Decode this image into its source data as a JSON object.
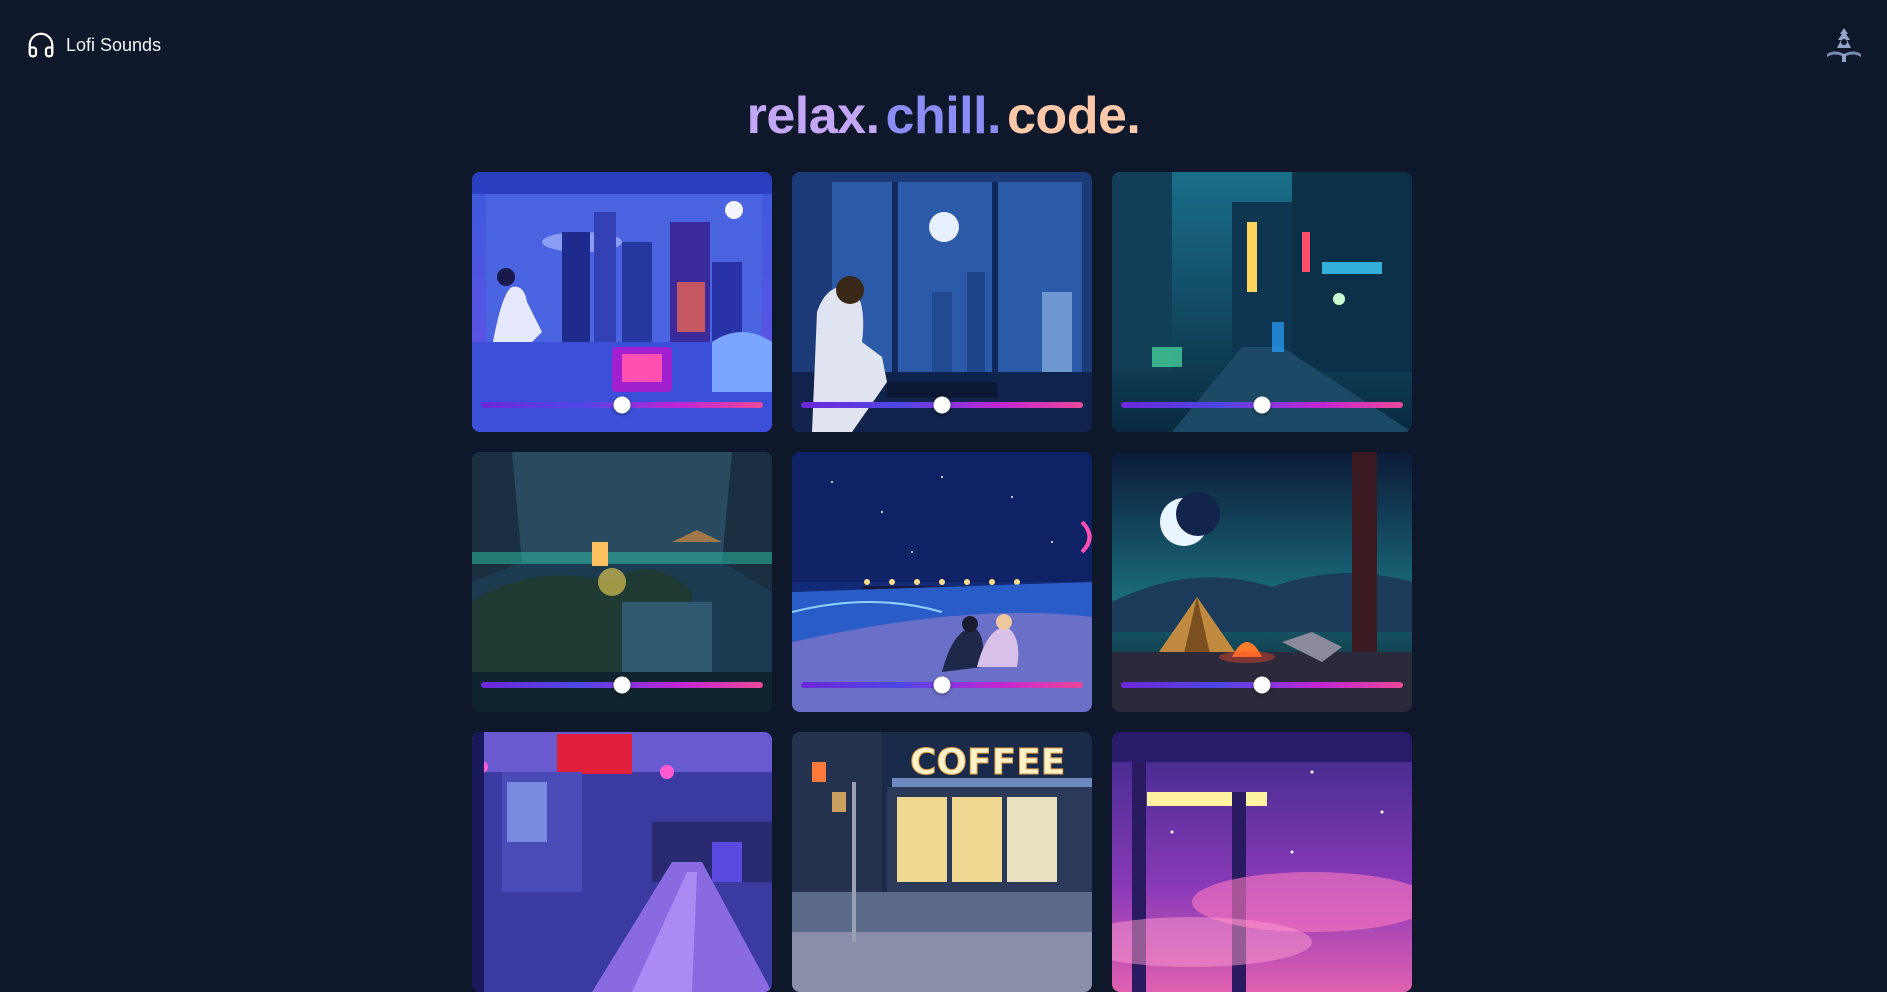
{
  "app": {
    "title": "Lofi Sounds",
    "headphones_icon": "headphones-icon",
    "logo_icon": "app-logo-icon"
  },
  "headline": {
    "word1": "relax.",
    "word2": "chill.",
    "word3": "code."
  },
  "colors": {
    "background": "#0f172a",
    "word1": "#c4a6f7",
    "word2": "#8b8cf6",
    "word3": "#fdc8a8",
    "slider_gradient": [
      "#6d28d9",
      "#4f46e5",
      "#c026d3",
      "#ec4899"
    ]
  },
  "cards": [
    {
      "scene": "girl-window-city-night",
      "volume": 0.5
    },
    {
      "scene": "man-rainy-window-moon",
      "volume": 0.5
    },
    {
      "scene": "rainy-neon-street",
      "volume": 0.5
    },
    {
      "scene": "forest-lantern-waterfall",
      "volume": 0.5
    },
    {
      "scene": "couple-beach-night",
      "volume": 0.5
    },
    {
      "scene": "campfire-tent-moon",
      "volume": 0.5
    },
    {
      "scene": "train-station-neon"
    },
    {
      "scene": "coffee-shop-night"
    },
    {
      "scene": "pink-sky-window"
    }
  ]
}
